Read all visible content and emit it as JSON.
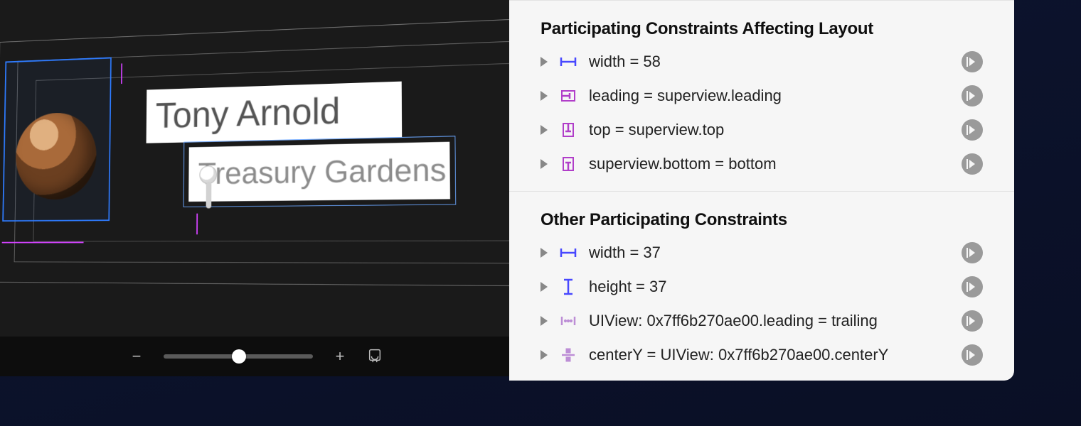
{
  "canvas": {
    "name_label_text": "Tony Arnold",
    "subtitle_label_text": "Treasury Gardens"
  },
  "sections": [
    {
      "title": "Participating Constraints Affecting Layout",
      "constraints": [
        {
          "icon": "width",
          "text": "width = 58"
        },
        {
          "icon": "leading",
          "text": "leading = superview.leading"
        },
        {
          "icon": "top",
          "text": "top = superview.top"
        },
        {
          "icon": "bottom",
          "text": "superview.bottom = bottom"
        }
      ]
    },
    {
      "title": "Other Participating Constraints",
      "constraints": [
        {
          "icon": "width",
          "text": "width = 37"
        },
        {
          "icon": "height",
          "text": "height = 37"
        },
        {
          "icon": "hspace",
          "text": "UIView: 0x7ff6b270ae00.leading = trailing"
        },
        {
          "icon": "centery",
          "text": "centerY = UIView: 0x7ff6b270ae00.centerY"
        }
      ]
    }
  ],
  "icon_colors": {
    "blue": "#4848ff",
    "purple": "#b13ec9",
    "lilac": "#bd8ed6"
  }
}
